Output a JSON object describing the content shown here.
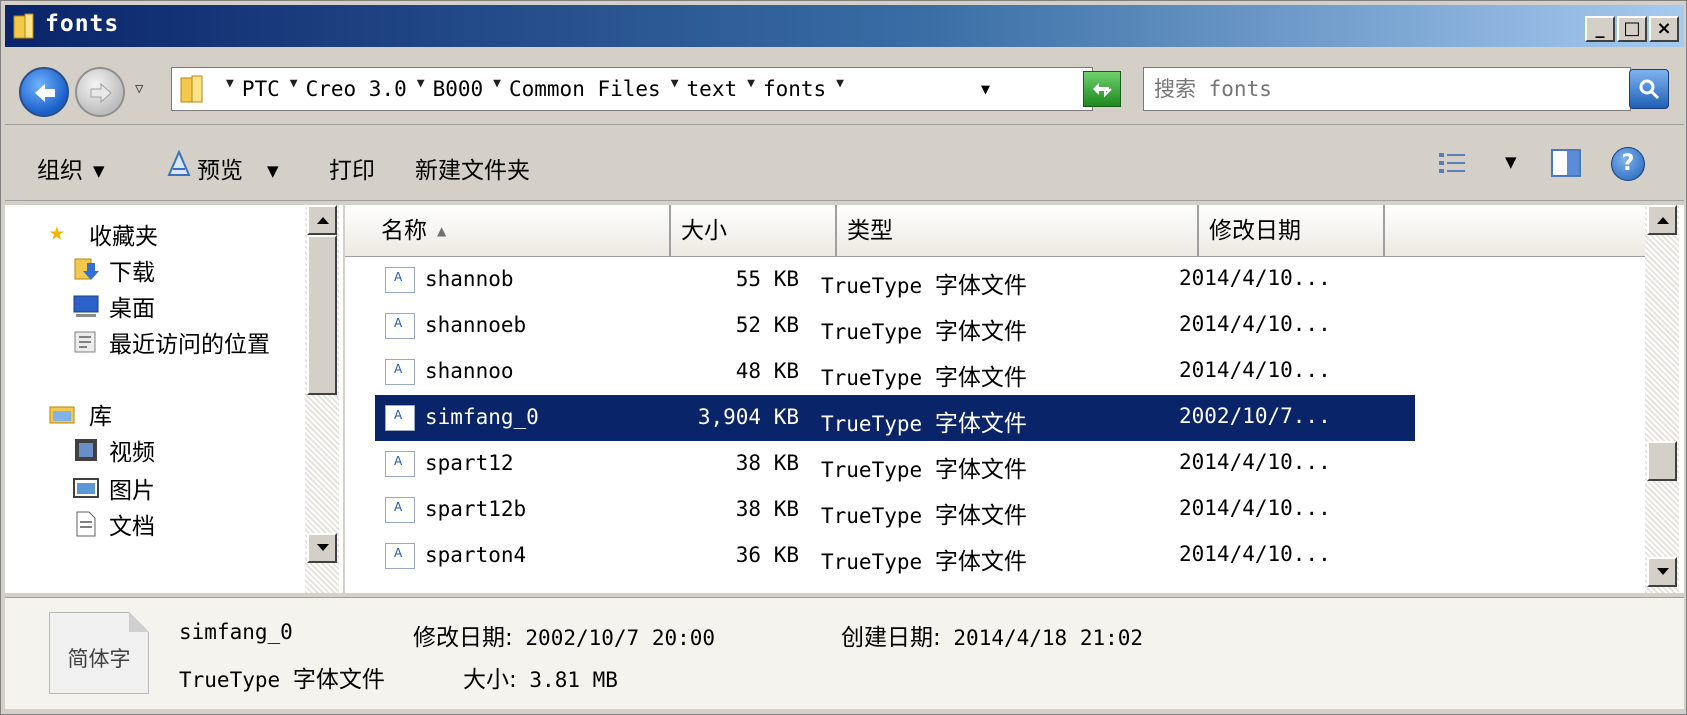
{
  "window": {
    "title": "fonts",
    "buttons": {
      "minimize": "_",
      "maximize": "□",
      "close": "×"
    }
  },
  "address": {
    "breadcrumbs": [
      "PTC",
      "Creo 3.0",
      "B000",
      "Common Files",
      "text",
      "fonts"
    ]
  },
  "search": {
    "placeholder": "搜索 fonts"
  },
  "toolbar": {
    "organize": "组织",
    "preview": "预览",
    "print": "打印",
    "new_folder": "新建文件夹"
  },
  "navpane": {
    "favorites": "收藏夹",
    "downloads": "下载",
    "desktop": "桌面",
    "recent": "最近访问的位置",
    "libraries": "库",
    "videos": "视频",
    "pictures": "图片",
    "documents": "文档"
  },
  "columns": {
    "name": "名称",
    "size": "大小",
    "type": "类型",
    "modified": "修改日期"
  },
  "files": [
    {
      "name": "shannob",
      "size": "55 KB",
      "type_prefix": "TrueType",
      "type_suffix": "字体文件",
      "date": "2014/4/10..."
    },
    {
      "name": "shannoeb",
      "size": "52 KB",
      "type_prefix": "TrueType",
      "type_suffix": "字体文件",
      "date": "2014/4/10..."
    },
    {
      "name": "shannoo",
      "size": "48 KB",
      "type_prefix": "TrueType",
      "type_suffix": "字体文件",
      "date": "2014/4/10..."
    },
    {
      "name": "simfang_0",
      "size": "3,904 KB",
      "type_prefix": "TrueType",
      "type_suffix": "字体文件",
      "date": "2002/10/7..."
    },
    {
      "name": "spart12",
      "size": "38 KB",
      "type_prefix": "TrueType",
      "type_suffix": "字体文件",
      "date": "2014/4/10..."
    },
    {
      "name": "spart12b",
      "size": "38 KB",
      "type_prefix": "TrueType",
      "type_suffix": "字体文件",
      "date": "2014/4/10..."
    },
    {
      "name": "sparton4",
      "size": "36 KB",
      "type_prefix": "TrueType",
      "type_suffix": "字体文件",
      "date": "2014/4/10..."
    }
  ],
  "details": {
    "thumb_text": "简体字",
    "name": "simfang_0",
    "modified_label": "修改日期:",
    "modified_value": "2002/10/7 20:00",
    "created_label": "创建日期:",
    "created_value": "2014/4/18 21:02",
    "type_prefix": "TrueType",
    "type_suffix": "字体文件",
    "size_label": "大小:",
    "size_value": "3.81 MB"
  },
  "colors": {
    "selection": "#0a246a",
    "title_start": "#0a246a",
    "title_end": "#a6caf0"
  }
}
